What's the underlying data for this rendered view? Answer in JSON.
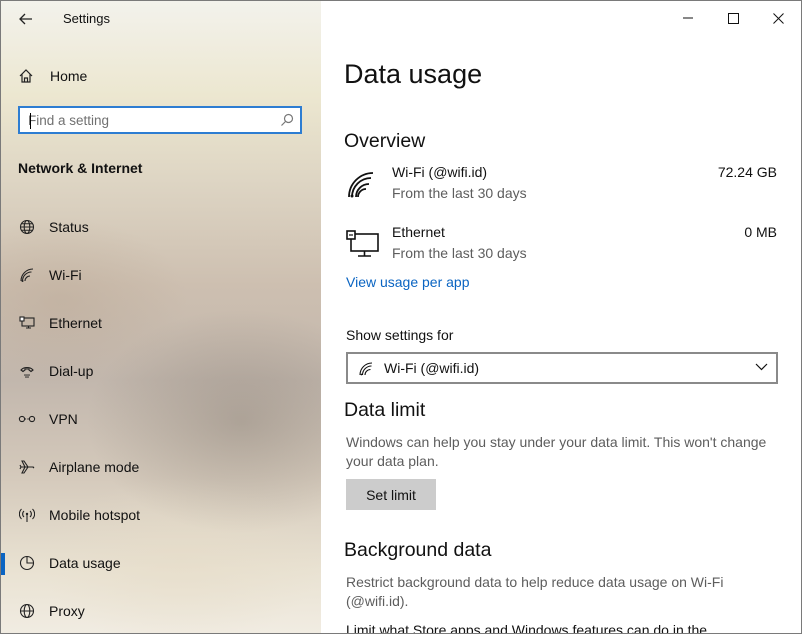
{
  "app": {
    "title": "Settings"
  },
  "sidebar": {
    "home_label": "Home",
    "search_placeholder": "Find a setting",
    "section_title": "Network & Internet",
    "items": [
      {
        "label": "Status",
        "icon": "globe-icon"
      },
      {
        "label": "Wi-Fi",
        "icon": "wifi-icon"
      },
      {
        "label": "Ethernet",
        "icon": "ethernet-icon"
      },
      {
        "label": "Dial-up",
        "icon": "dialup-icon"
      },
      {
        "label": "VPN",
        "icon": "vpn-icon"
      },
      {
        "label": "Airplane mode",
        "icon": "airplane-icon"
      },
      {
        "label": "Mobile hotspot",
        "icon": "hotspot-icon"
      },
      {
        "label": "Data usage",
        "icon": "data-usage-icon",
        "selected": true
      },
      {
        "label": "Proxy",
        "icon": "proxy-icon"
      }
    ]
  },
  "main": {
    "page_title": "Data usage",
    "overview": {
      "heading": "Overview",
      "rows": [
        {
          "name": "Wi-Fi (@wifi.id)",
          "sub": "From the last 30 days",
          "value": "72.24 GB",
          "icon": "wifi-signal-icon"
        },
        {
          "name": "Ethernet",
          "sub": "From the last 30 days",
          "value": "0 MB",
          "icon": "ethernet-monitor-icon"
        }
      ],
      "link": "View usage per app"
    },
    "show_settings": {
      "label": "Show settings for",
      "selected": "Wi-Fi (@wifi.id)"
    },
    "data_limit": {
      "heading": "Data limit",
      "description": "Windows can help you stay under your data limit. This won't change your data plan.",
      "button": "Set limit"
    },
    "background_data": {
      "heading": "Background data",
      "description": "Restrict background data to help reduce data usage on Wi-Fi (@wifi.id).",
      "cut_text": "Limit what Store apps and Windows features can do in the"
    }
  },
  "colors": {
    "accent": "#0a64c2",
    "search_border": "#2d7dd2"
  }
}
